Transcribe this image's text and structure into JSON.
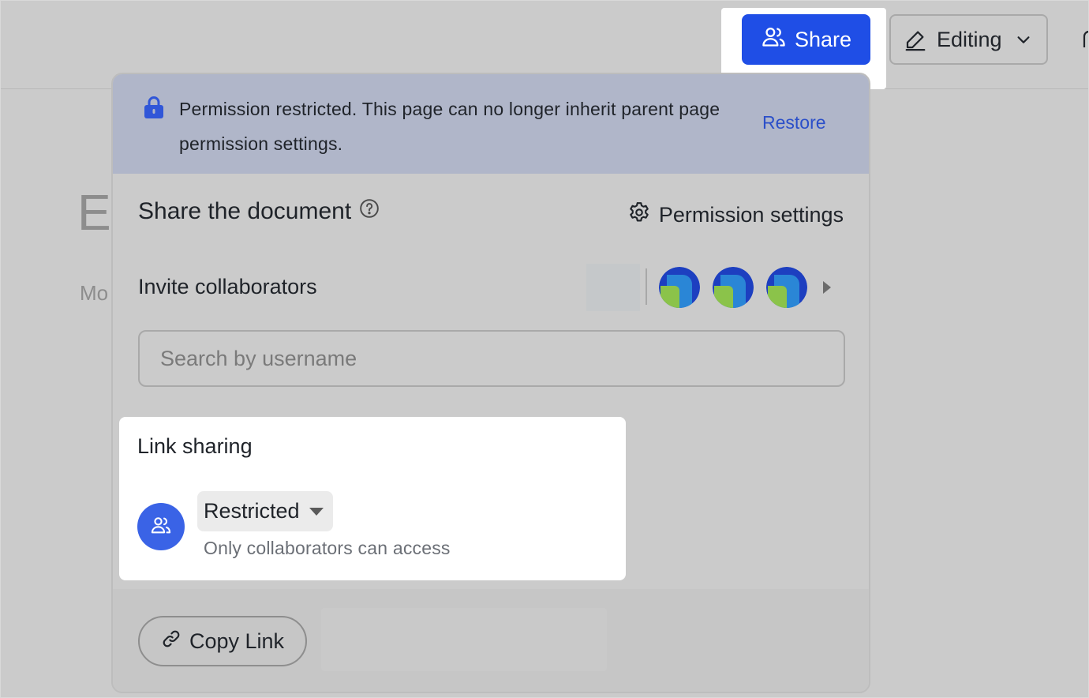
{
  "header": {
    "share_label": "Share",
    "editing_label": "Editing"
  },
  "background": {
    "title_fragment": "E",
    "text_fragment": "Mo"
  },
  "banner": {
    "message": "Permission restricted. This page can no longer inherit parent page permission settings.",
    "restore_label": "Restore"
  },
  "share": {
    "title": "Share the document",
    "permission_settings_label": "Permission settings"
  },
  "invite": {
    "label": "Invite collaborators",
    "search_placeholder": "Search by username",
    "search_value": ""
  },
  "link_sharing": {
    "title": "Link sharing",
    "access_level": "Restricted",
    "description": "Only collaborators can access"
  },
  "footer": {
    "copy_link_label": "Copy Link"
  },
  "colors": {
    "primary": "#1f4ee6",
    "banner_bg": "#b0b6c9",
    "link": "#2b4fc9"
  },
  "icons": [
    "users-icon",
    "pencil-icon",
    "chevron-down-icon",
    "lock-icon",
    "help-icon",
    "gear-icon",
    "caret-right-icon",
    "caret-down-icon",
    "link-icon"
  ]
}
